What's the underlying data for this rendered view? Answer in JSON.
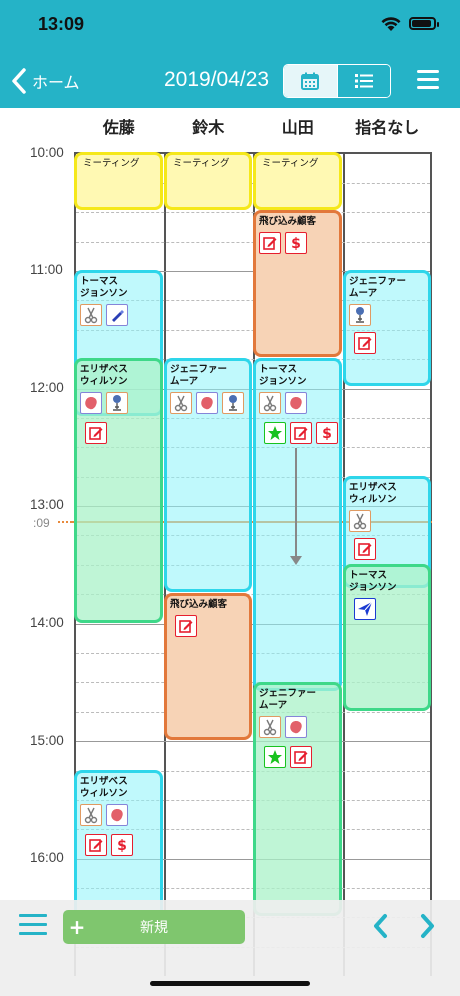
{
  "status_bar": {
    "time": "13:09"
  },
  "nav": {
    "back_label": "ホーム",
    "date": "2019/04/23",
    "view_toggle": [
      "calendar-icon",
      "list-icon"
    ],
    "menu_icon": "menu-icon"
  },
  "staff": [
    "佐藤",
    "鈴木",
    "山田",
    "指名なし"
  ],
  "times": [
    "10:00",
    "11:00",
    "12:00",
    "13:00",
    "14:00",
    "15:00",
    "16:00"
  ],
  "now_label": ":09",
  "events": {
    "sato_meeting": "ミーティング",
    "suzuki_meeting": "ミーティング",
    "yamada_meeting": "ミーティング",
    "yamada_walkin": "飛び込み顧客",
    "sato_thomas": "トーマス\nジョンソン",
    "shimei_jennifer": "ジェニファー\nムーア",
    "sato_elizabeth": "エリザベス\nウィルソン",
    "suzuki_jennifer": "ジェニファー\nムーア",
    "yamada_thomas": "トーマス\nジョンソン",
    "shimei_elizabeth": "エリザベス\nウィルソン",
    "shimei_thomas": "トーマス\nジョンソン",
    "suzuki_walkin": "飛び込み顧客",
    "yamada_jennifer": "ジェニファー\nムーア",
    "sato_elizabeth2": "エリザベス\nウィルソン"
  },
  "colors": {
    "accent": "#25b3c7",
    "meeting": "#f5e81a",
    "reservation": "#2ed6ea",
    "in_service": "#3ed889",
    "walk_in": "#e2783b",
    "now_line": "#e88a3c"
  },
  "bottom": {
    "new_label": "新規",
    "new_plus": "+"
  }
}
